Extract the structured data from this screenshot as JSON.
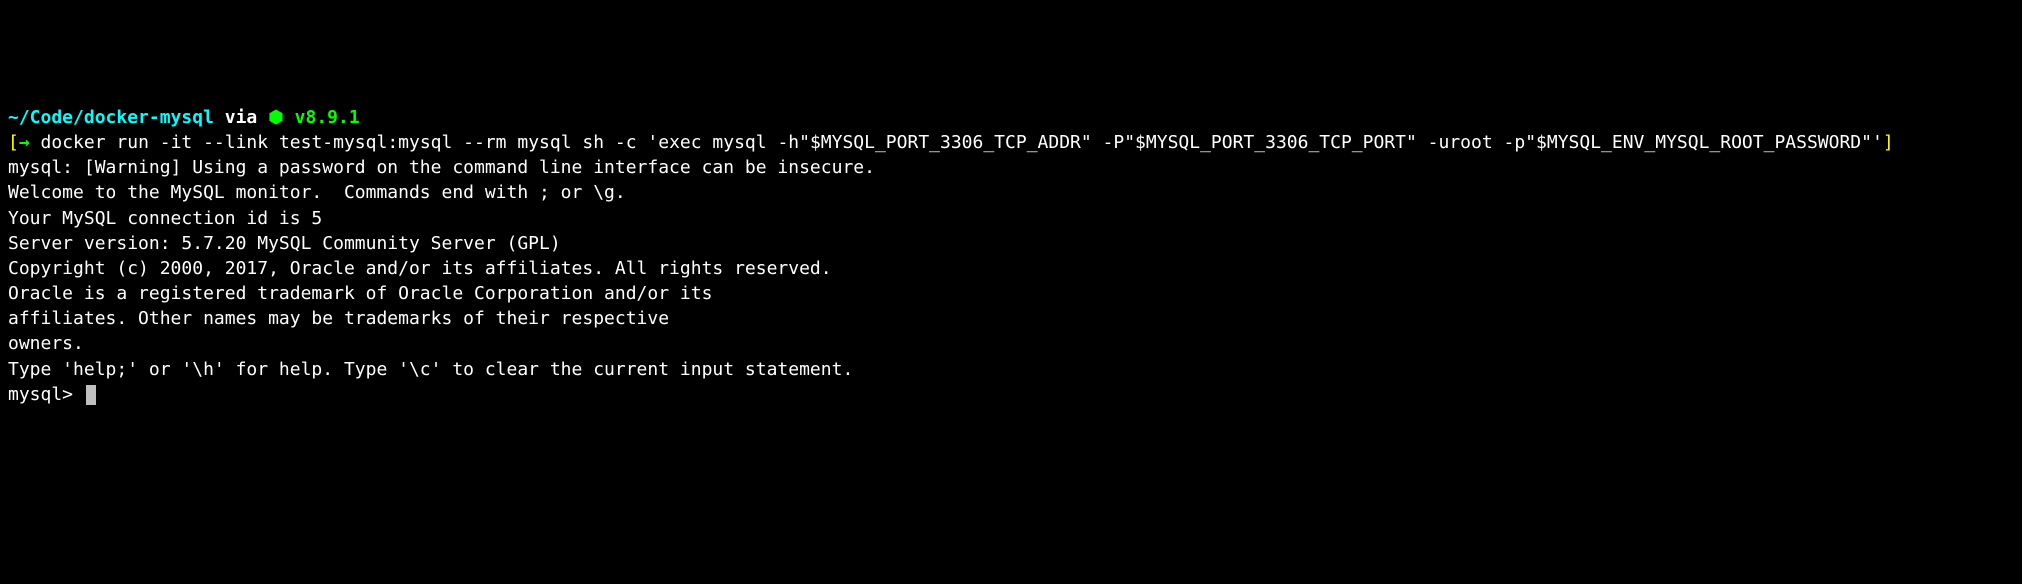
{
  "prompt": {
    "path": "~/Code/docker-mysql",
    "via": " via ",
    "hex_icon": "⬢",
    "version": " v8.9.1",
    "bracket_open": "[",
    "arrow": "→ ",
    "bracket_close": "]"
  },
  "command": "docker run -it --link test-mysql:mysql --rm mysql sh -c 'exec mysql -h\"$MYSQL_PORT_3306_TCP_ADDR\" -P\"$MYSQL_PORT_3306_TCP_PORT\" -uroot -p\"$MYSQL_ENV_MYSQL_ROOT_PASSWORD\"'",
  "output": {
    "line1": "mysql: [Warning] Using a password on the command line interface can be insecure.",
    "line2": "Welcome to the MySQL monitor.  Commands end with ; or \\g.",
    "line3": "Your MySQL connection id is 5",
    "line4": "Server version: 5.7.20 MySQL Community Server (GPL)",
    "line5": "",
    "line6": "Copyright (c) 2000, 2017, Oracle and/or its affiliates. All rights reserved.",
    "line7": "",
    "line8": "Oracle is a registered trademark of Oracle Corporation and/or its",
    "line9": "affiliates. Other names may be trademarks of their respective",
    "line10": "owners.",
    "line11": "",
    "line12": "Type 'help;' or '\\h' for help. Type '\\c' to clear the current input statement.",
    "line13": ""
  },
  "mysql_prompt": "mysql> "
}
